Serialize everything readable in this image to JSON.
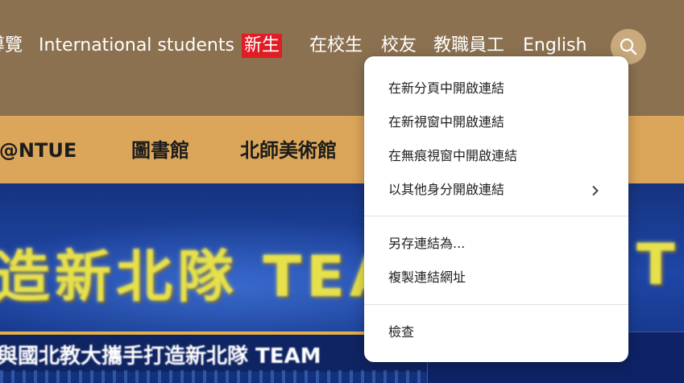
{
  "top_nav": {
    "items": [
      {
        "label": "導覽"
      },
      {
        "label": "International students"
      },
      {
        "label": "新生"
      },
      {
        "label": "在校生"
      },
      {
        "label": "校友"
      },
      {
        "label": "教職員工"
      },
      {
        "label": "English"
      }
    ],
    "search_icon": "search-icon"
  },
  "sub_nav": {
    "items": [
      {
        "label": "I@NTUE"
      },
      {
        "label": "圖書館"
      },
      {
        "label": "北師美術館"
      }
    ]
  },
  "hero": {
    "title": "造新北隊 TEAM",
    "title_right": "T",
    "subtitle": "與國北教大攜手打造新北隊 TEAM"
  },
  "context_menu": {
    "groups": [
      [
        {
          "label": "在新分頁中開啟連結"
        },
        {
          "label": "在新視窗中開啟連結"
        },
        {
          "label": "在無痕視窗中開啟連結"
        },
        {
          "label": "以其他身分開啟連結",
          "submenu_icon": "chevron-right-icon"
        }
      ],
      [
        {
          "label": "另存連結為..."
        },
        {
          "label": "複製連結網址"
        }
      ],
      [
        {
          "label": "檢查"
        }
      ]
    ]
  },
  "colors": {
    "header_bg": "#8b7150",
    "subnav_bg": "#dca65a",
    "new_badge": "#e21c25",
    "hero_text": "#e6e04a"
  }
}
